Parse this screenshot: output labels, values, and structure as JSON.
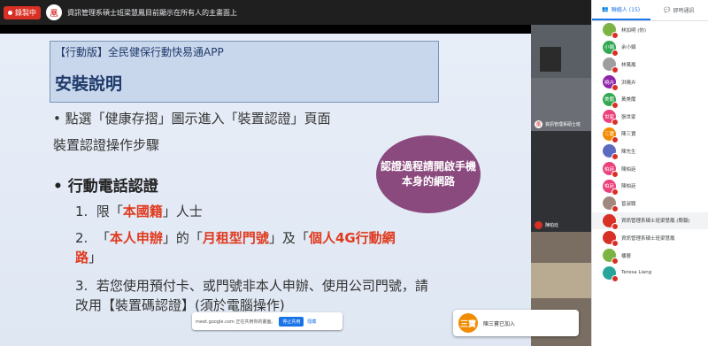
{
  "topbar": {
    "rec_label": "錄製中",
    "avatar_glyph": "凰",
    "title": "資訊管理系碩士班梁慧鳳目前顯示在所有人的主畫面上"
  },
  "slide": {
    "subtitle": "【行動版】全民健保行動快易通APP",
    "heading": "安裝說明",
    "bullet1": "• 點選「健康存摺」圖示進入「裝置認證」頁面",
    "bullet2": "裝置認證操作步驟",
    "bullet3": "• 行動電話認證",
    "item1_num": "1.",
    "item1_a": "限「",
    "item1_red": "本國籍",
    "item1_b": "」人士",
    "item2_num": "2.",
    "item2_a": "「",
    "item2_red1": "本人申辦",
    "item2_b": "」的「",
    "item2_red2": "月租型門號",
    "item2_c": "」及「",
    "item2_red3": "個人4G行動網路",
    "item2_d": "」",
    "item3_num": "3.",
    "item3_text": "若您使用預付卡、或門號非本人申辦、使用公司門號，請改用【裝置碼認證】(須於電腦操作)",
    "callout": "認證過程請開啟手機本身的網路"
  },
  "share": {
    "text": "meet.google.com 正在共用你的畫面。",
    "stop": "停止共用",
    "hide": "隱藏"
  },
  "tiles": [
    {
      "name": "資訊管理系碩士班"
    },
    {
      "name": "陳柏廷"
    }
  ],
  "toast": {
    "avatar": "三寶",
    "text": "陳三寶已加入"
  },
  "panel": {
    "tab_people": "聯絡人 (15)",
    "tab_chat": "即時通訊",
    "participants": [
      {
        "avatar": "",
        "name": "林加明 (你)",
        "color": "#7cb342"
      },
      {
        "avatar": "小娟",
        "name": "余小娟",
        "color": "#33a852"
      },
      {
        "avatar": "",
        "name": "林萬鳳",
        "color": "#9e9e9e"
      },
      {
        "avatar": "曉卉",
        "name": "洪曉卉",
        "color": "#8e24aa"
      },
      {
        "avatar": "美蘭",
        "name": "黃美蘭",
        "color": "#33a852"
      },
      {
        "avatar": "世家",
        "name": "張世家",
        "color": "#ec407a"
      },
      {
        "avatar": "三寶",
        "name": "陳三寶",
        "color": "#f28b00"
      },
      {
        "avatar": "",
        "name": "陳先生",
        "color": "#5c6bc0"
      },
      {
        "avatar": "柏廷",
        "name": "陳柏廷",
        "color": "#ec407a"
      },
      {
        "avatar": "柏廷",
        "name": "陳柏廷",
        "color": "#ec407a"
      },
      {
        "avatar": "",
        "name": "曾淑聰",
        "color": "#a1887f"
      },
      {
        "avatar": "",
        "name": "資訊管理系碩士班梁慧鳳 (簡報)",
        "color": "#d93025"
      },
      {
        "avatar": "",
        "name": "資訊管理系碩士班梁慧鳳",
        "color": "#d93025"
      },
      {
        "avatar": "",
        "name": "樓層",
        "color": "#7cb342"
      },
      {
        "avatar": "",
        "name": "Teresa Liang",
        "color": "#26a69a"
      }
    ]
  }
}
